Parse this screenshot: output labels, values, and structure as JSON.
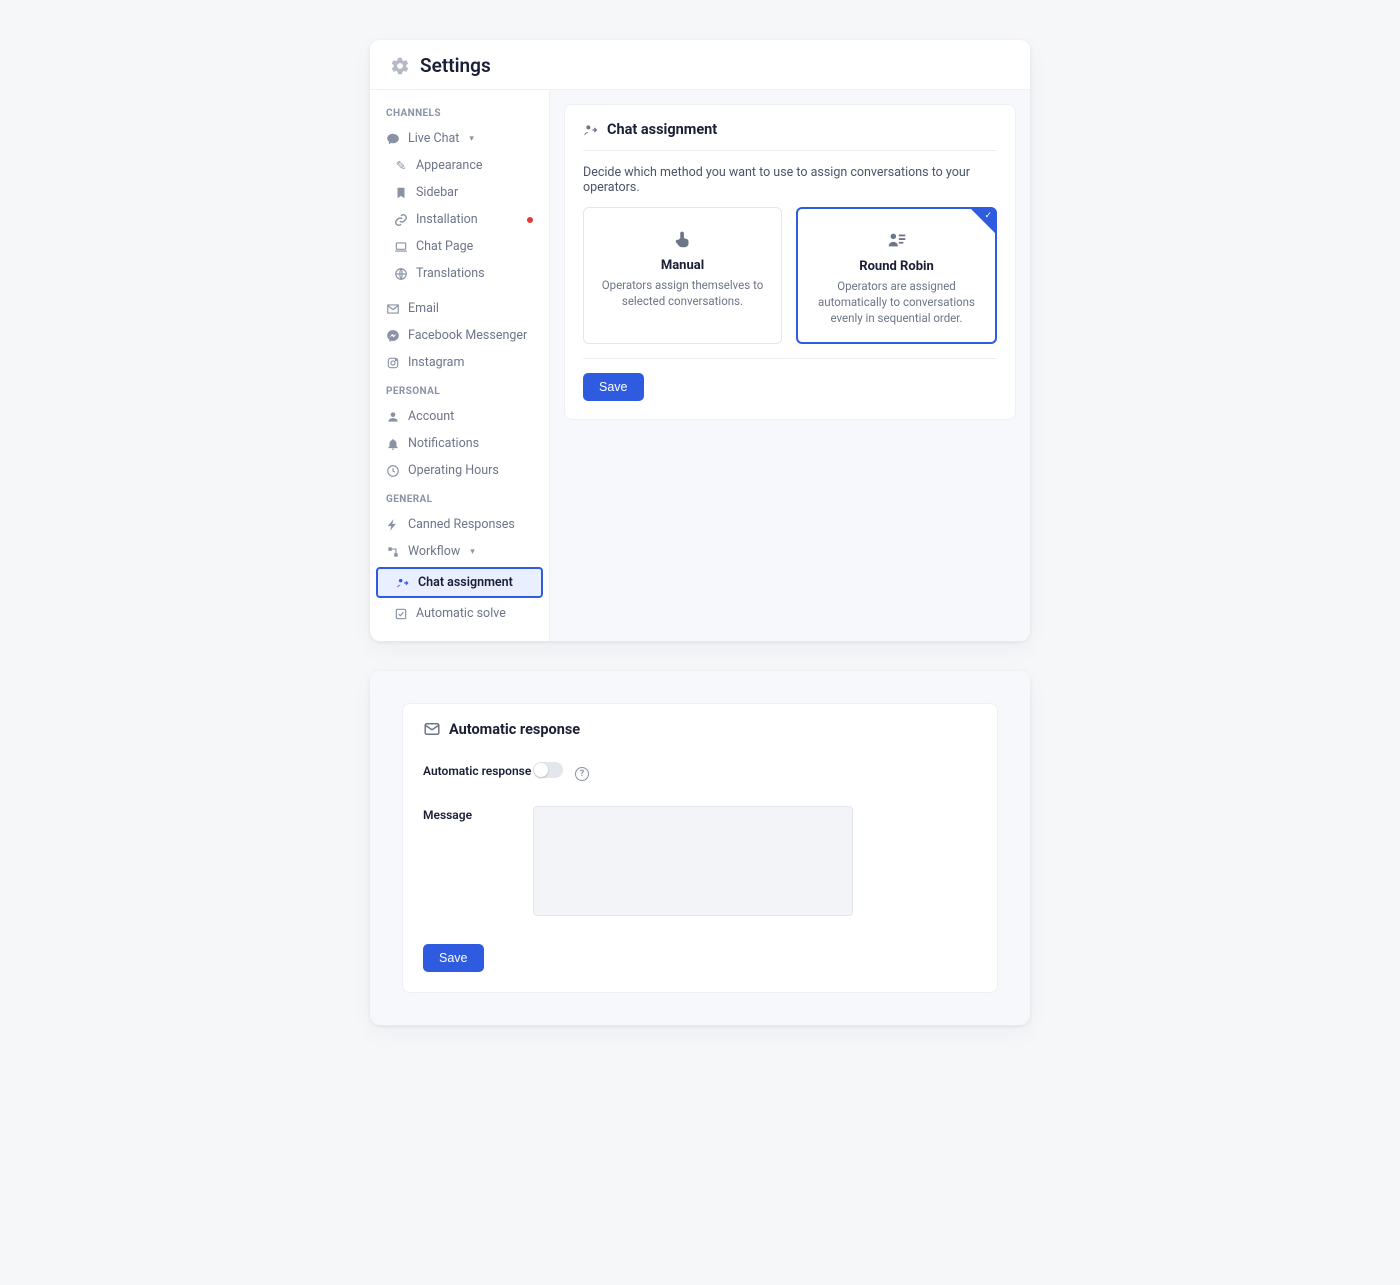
{
  "header": {
    "title": "Settings"
  },
  "sidebar": {
    "sections": {
      "channels": {
        "label": "CHANNELS",
        "live_chat": "Live Chat",
        "appearance": "Appearance",
        "sidebar_item": "Sidebar",
        "installation": "Installation",
        "chat_page": "Chat Page",
        "translations": "Translations",
        "email": "Email",
        "messenger": "Facebook Messenger",
        "instagram": "Instagram"
      },
      "personal": {
        "label": "PERSONAL",
        "account": "Account",
        "notifications": "Notifications",
        "operating_hours": "Operating Hours"
      },
      "general": {
        "label": "GENERAL",
        "canned": "Canned Responses",
        "workflow": "Workflow",
        "chat_assignment": "Chat assignment",
        "automatic_solve": "Automatic solve"
      }
    }
  },
  "main": {
    "card_title": "Chat assignment",
    "description": "Decide which method you want to use to assign conversations to your operators.",
    "options": {
      "manual": {
        "title": "Manual",
        "desc": "Operators assign themselves to selected conversations."
      },
      "round_robin": {
        "title": "Round Robin",
        "desc": "Operators are assigned automatically to conversations evenly in sequential order."
      }
    },
    "save_label": "Save"
  },
  "auto_response": {
    "card_title": "Automatic response",
    "toggle_label": "Automatic response",
    "message_label": "Message",
    "save_label": "Save"
  }
}
